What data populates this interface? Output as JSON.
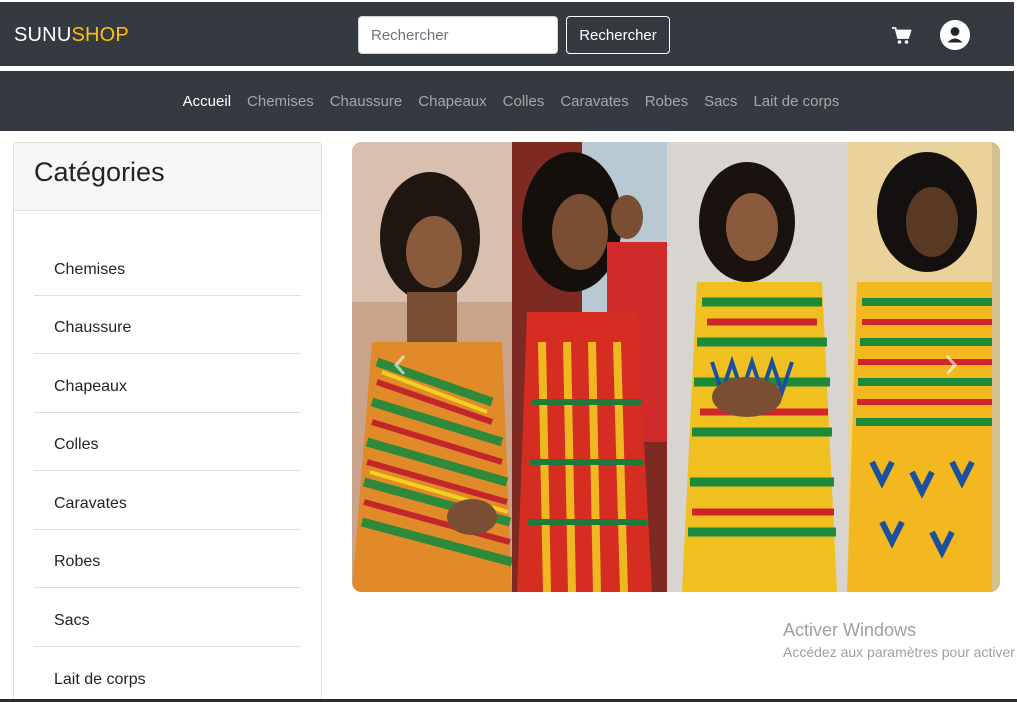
{
  "header": {
    "brand_part1": "SUNU",
    "brand_part2": "SHOP",
    "search_placeholder": "Rechercher",
    "search_button": "Rechercher",
    "cart_icon": "cart-icon",
    "account_icon": "user-avatar-icon"
  },
  "nav": {
    "links": [
      "Accueil",
      "Chemises",
      "Chaussure",
      "Chapeaux",
      "Colles",
      "Caravates",
      "Robes",
      "Sacs",
      "Lait de corps"
    ],
    "active": "Accueil"
  },
  "categories": {
    "title": "Catégories",
    "items": [
      "Chemises",
      "Chaussure",
      "Chapeaux",
      "Colles",
      "Caravates",
      "Robes",
      "Sacs",
      "Lait de corps"
    ]
  },
  "carousel": {
    "image_description": "four women in colorful kente fabric dresses",
    "prev_icon": "chevron-left-icon",
    "next_icon": "chevron-right-icon"
  },
  "windows_activation": {
    "title": "Activer Windows",
    "subtitle": "Accédez aux paramètres pour activer"
  },
  "colors": {
    "nav_bg": "#343a40",
    "brand_accent": "#ffc107"
  }
}
